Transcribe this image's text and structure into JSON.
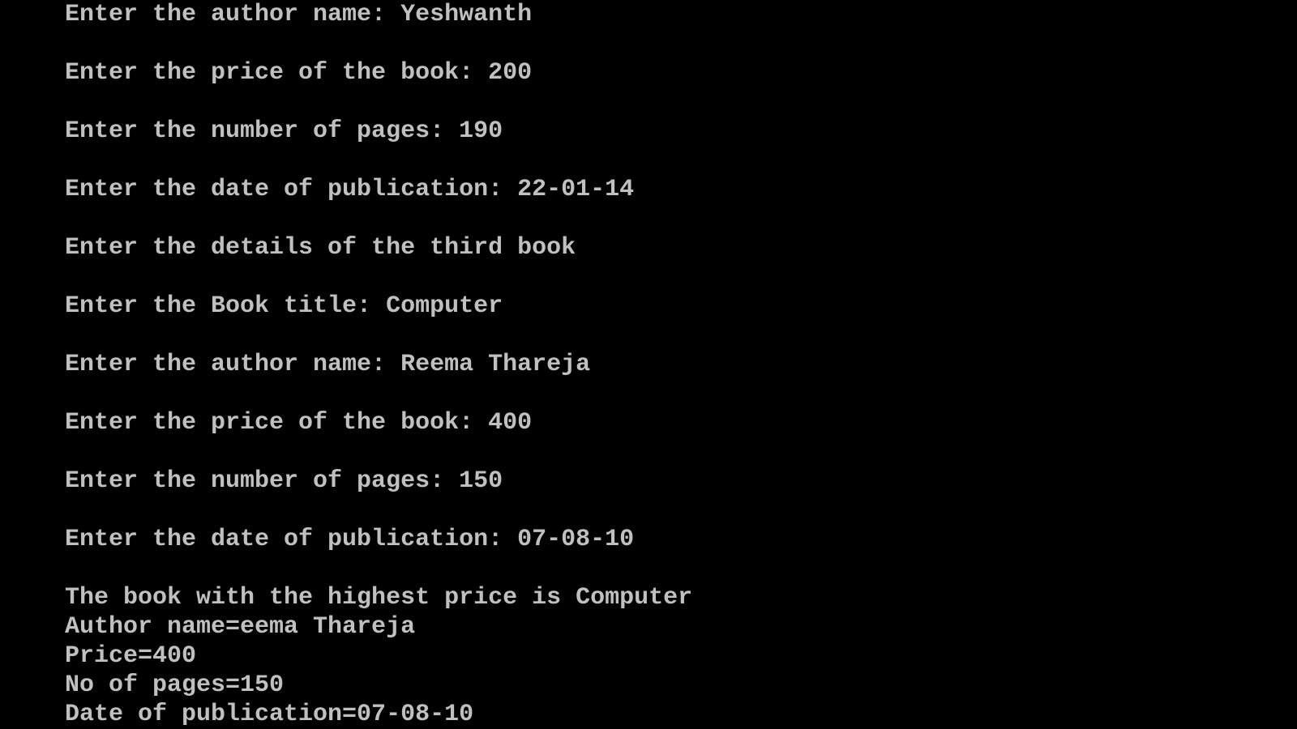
{
  "console": {
    "lines": [
      "Enter the author name: Yeshwanth",
      "",
      "Enter the price of the book: 200",
      "",
      "Enter the number of pages: 190",
      "",
      "Enter the date of publication: 22-01-14",
      "",
      "Enter the details of the third book",
      "",
      "Enter the Book title: Computer",
      "",
      "Enter the author name: Reema Thareja",
      "",
      "Enter the price of the book: 400",
      "",
      "Enter the number of pages: 150",
      "",
      "Enter the date of publication: 07-08-10",
      "",
      "The book with the highest price is Computer",
      "Author name=eema Thareja",
      "Price=400",
      "No of pages=150",
      "Date of publication=07-08-10"
    ],
    "text_color": "#c0c0c0",
    "background_color": "#000000"
  }
}
